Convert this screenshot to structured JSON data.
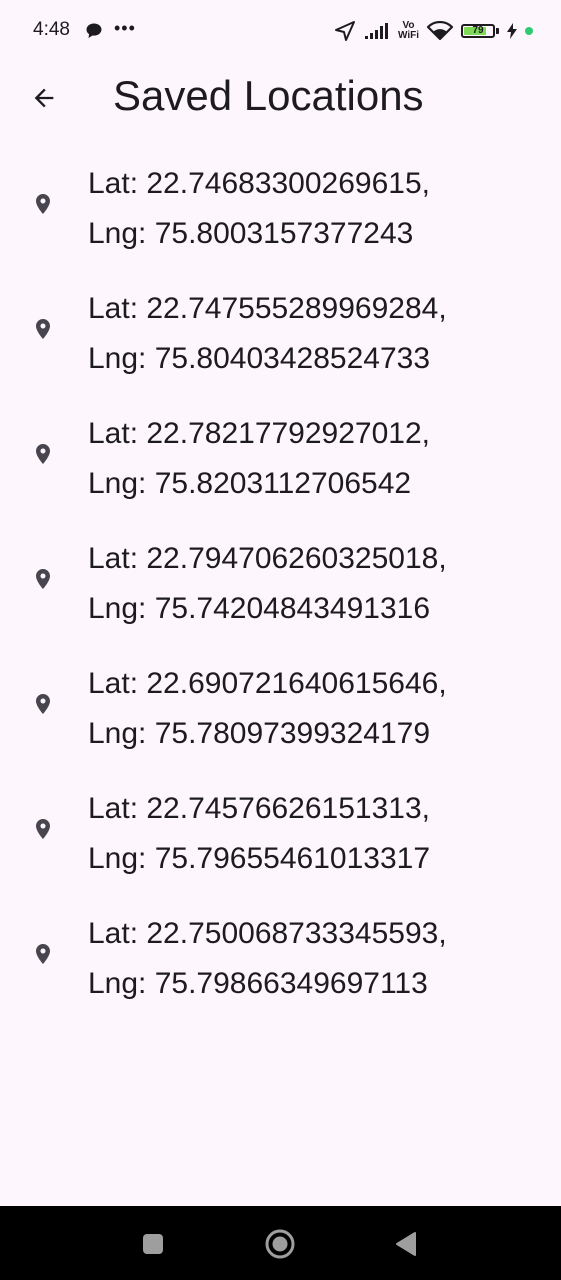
{
  "status_bar": {
    "time": "4:48",
    "vowifi_top": "Vo",
    "vowifi_bottom": "WiFi",
    "battery_level": "79",
    "battery_fraction": 0.79,
    "icons": [
      "chat-bubble-icon",
      "more-dots-icon",
      "location-arrow-icon",
      "signal-icon",
      "wifi-icon",
      "battery-icon",
      "charging-bolt-icon"
    ]
  },
  "header": {
    "title": "Saved Locations",
    "back_icon": "arrow-left-icon"
  },
  "locations": [
    {
      "lat": "Lat: 22.74683300269615,",
      "lng": "Lng: 75.8003157377243"
    },
    {
      "lat": "Lat: 22.747555289969284,",
      "lng": "Lng: 75.80403428524733"
    },
    {
      "lat": "Lat: 22.78217792927012,",
      "lng": "Lng: 75.8203112706542"
    },
    {
      "lat": "Lat: 22.794706260325018,",
      "lng": "Lng: 75.74204843491316"
    },
    {
      "lat": "Lat: 22.690721640615646,",
      "lng": "Lng: 75.78097399324179"
    },
    {
      "lat": "Lat: 22.74576626151313,",
      "lng": "Lng: 75.79655461013317"
    },
    {
      "lat": "Lat: 22.750068733345593,",
      "lng": "Lng: 75.79866349697113"
    }
  ],
  "nav": {
    "icons": [
      "recents-square-icon",
      "home-circle-icon",
      "back-triangle-icon"
    ]
  },
  "colors": {
    "background": "#fdf7fd",
    "text": "#1d1b20",
    "icon": "#49454f",
    "battery_fill": "#7ed957",
    "nav_bar": "#000000"
  }
}
